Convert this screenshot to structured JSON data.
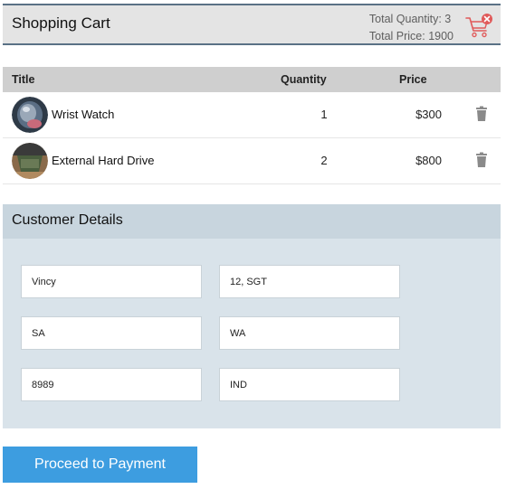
{
  "header": {
    "title": "Shopping Cart",
    "total_quantity": "Total Quantity: 3",
    "total_price": "Total Price: 1900",
    "cart_icon": "cart-clear-icon",
    "accent_color": "#e05a5a"
  },
  "table": {
    "columns": {
      "title": "Title",
      "quantity": "Quantity",
      "price": "Price"
    },
    "rows": [
      {
        "title": "Wrist Watch",
        "quantity": "1",
        "price": "$300",
        "thumb_icon": "wrist-watch-thumbnail",
        "delete_icon": "trash-icon"
      },
      {
        "title": "External Hard Drive",
        "quantity": "2",
        "price": "$800",
        "thumb_icon": "hard-drive-thumbnail",
        "delete_icon": "trash-icon"
      }
    ]
  },
  "customer": {
    "title": "Customer Details",
    "fields": {
      "name": "Vincy",
      "address": "12, SGT",
      "city": "SA",
      "state": "WA",
      "zip": "8989",
      "country": "IND"
    }
  },
  "actions": {
    "proceed_label": "Proceed to Payment",
    "button_color": "#3d9de0"
  }
}
